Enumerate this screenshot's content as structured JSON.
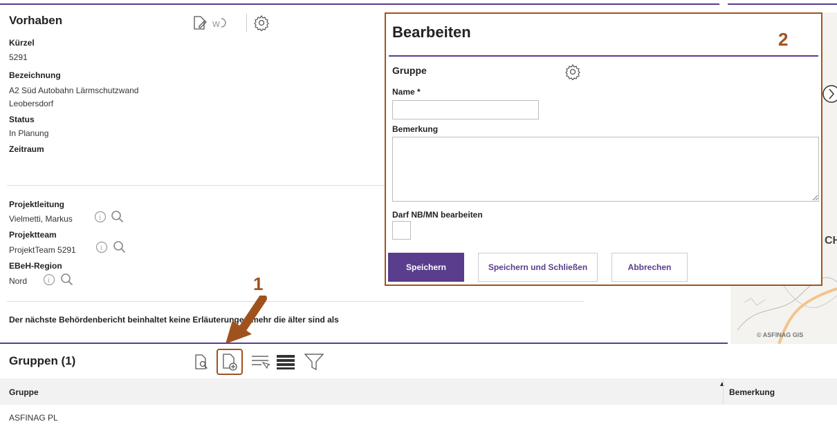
{
  "vorhaben": {
    "title": "Vorhaben",
    "fields": [
      {
        "label": "Kürzel",
        "value": "5291"
      },
      {
        "label": "Bezeichnung",
        "value": "A2 Süd Autobahn Lärmschutzwand Leobersdorf"
      },
      {
        "label": "Status",
        "value": "In Planung"
      },
      {
        "label": "Zeitraum",
        "value": ""
      }
    ],
    "people": [
      {
        "label": "Projektleitung",
        "value": "Vielmetti, Markus"
      },
      {
        "label": "Projektteam",
        "value": "ProjektTeam 5291"
      },
      {
        "label": "EBeH-Region",
        "value": "Nord"
      }
    ],
    "notice": "Der nächste Behördenbericht beinhaltet keine Erläuterungen mehr die älter sind als"
  },
  "gruppen": {
    "title": "Gruppen (1)",
    "columns": [
      "Gruppe",
      "Bemerkung"
    ],
    "rows": [
      {
        "gruppe": "ASFINAG PL",
        "bemerkung": ""
      }
    ]
  },
  "modal": {
    "title": "Bearbeiten",
    "section": "Gruppe",
    "name_label": "Name *",
    "name_value": "",
    "bemerkung_label": "Bemerkung",
    "bemerkung_value": "",
    "darf_label": "Darf NB/MN bearbeiten",
    "buttons": {
      "save": "Speichern",
      "save_close": "Speichern und Schließen",
      "cancel": "Abbrechen"
    }
  },
  "map": {
    "copyright": "© ASFINAG GIS",
    "partial_label": "CH"
  },
  "annotations": {
    "one": "1",
    "two": "2"
  },
  "colors": {
    "accent": "#5a3d8c",
    "annotation": "#a0521e"
  }
}
